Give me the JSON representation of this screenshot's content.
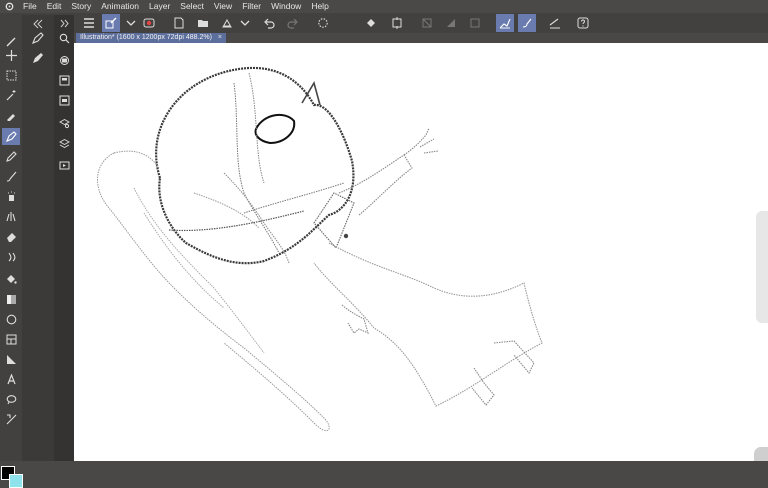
{
  "menu": {
    "items": [
      "File",
      "Edit",
      "Story",
      "Animation",
      "Layer",
      "Select",
      "View",
      "Filter",
      "Window",
      "Help"
    ]
  },
  "toolbar": {
    "buttons": [
      "menu-icon",
      "pen-tool-icon",
      "chevron-down-icon",
      "record-icon",
      "new-icon",
      "open-icon",
      "save-icon",
      "chevron-down-icon",
      "undo-icon",
      "redo-icon",
      "spinner-icon",
      "fill-icon",
      "transform-icon",
      "deselect-icon",
      "invert-icon",
      "selection-launcher-icon",
      "vector-pen-icon",
      "brush-icon",
      "ruler-icon",
      "help-icon"
    ]
  },
  "tab": {
    "title": "Illustration* (1600 x 1200px 72dpi 488.2%)",
    "close": "×"
  },
  "colors": {
    "main": "#000000",
    "sub": "#8fe3ec",
    "accent": "#6a7bb0"
  }
}
